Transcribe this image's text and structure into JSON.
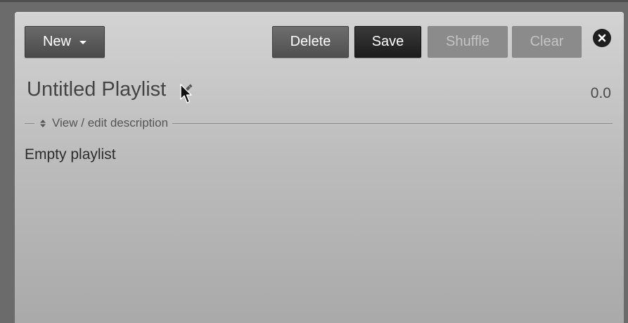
{
  "toolbar": {
    "new_label": "New",
    "delete_label": "Delete",
    "save_label": "Save",
    "shuffle_label": "Shuffle",
    "clear_label": "Clear"
  },
  "playlist": {
    "title": "Untitled Playlist",
    "count": "0.0",
    "description_toggle": "View / edit description",
    "empty_message": "Empty playlist"
  },
  "icons": {
    "new_dropdown": "caret-down-icon",
    "close": "close-icon",
    "edit_title": "pencil-icon",
    "description_toggle": "sort-arrows-icon",
    "cursor": "mouse-pointer"
  },
  "colors": {
    "primary_button": "#1c1c1c",
    "secondary_button": "#4f4f4f",
    "disabled_button": "#8b8b8b",
    "panel_top": "#d3d3d3",
    "panel_bottom": "#a9a9a9"
  }
}
